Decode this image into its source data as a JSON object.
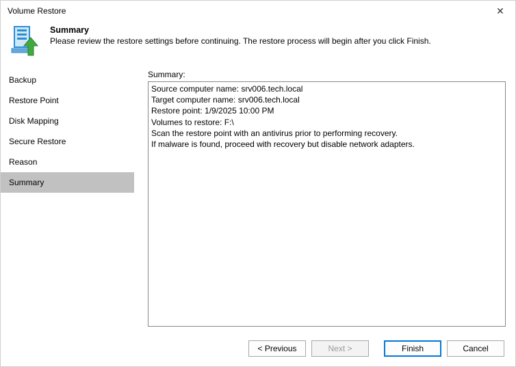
{
  "window": {
    "title": "Volume Restore"
  },
  "header": {
    "title": "Summary",
    "subtitle": "Please review the restore settings before continuing. The restore process will begin after you click Finish."
  },
  "sidebar": {
    "items": [
      {
        "label": "Backup",
        "active": false
      },
      {
        "label": "Restore Point",
        "active": false
      },
      {
        "label": "Disk Mapping",
        "active": false
      },
      {
        "label": "Secure Restore",
        "active": false
      },
      {
        "label": "Reason",
        "active": false
      },
      {
        "label": "Summary",
        "active": true
      }
    ]
  },
  "content": {
    "summary_label": "Summary:",
    "summary_text": "Source computer name: srv006.tech.local\nTarget computer name: srv006.tech.local\nRestore point: 1/9/2025 10:00 PM\nVolumes to restore: F:\\\nScan the restore point with an antivirus prior to performing recovery.\nIf malware is found, proceed with recovery but disable network adapters."
  },
  "footer": {
    "previous": "< Previous",
    "next": "Next >",
    "finish": "Finish",
    "cancel": "Cancel"
  },
  "icons": {
    "close": "✕"
  }
}
